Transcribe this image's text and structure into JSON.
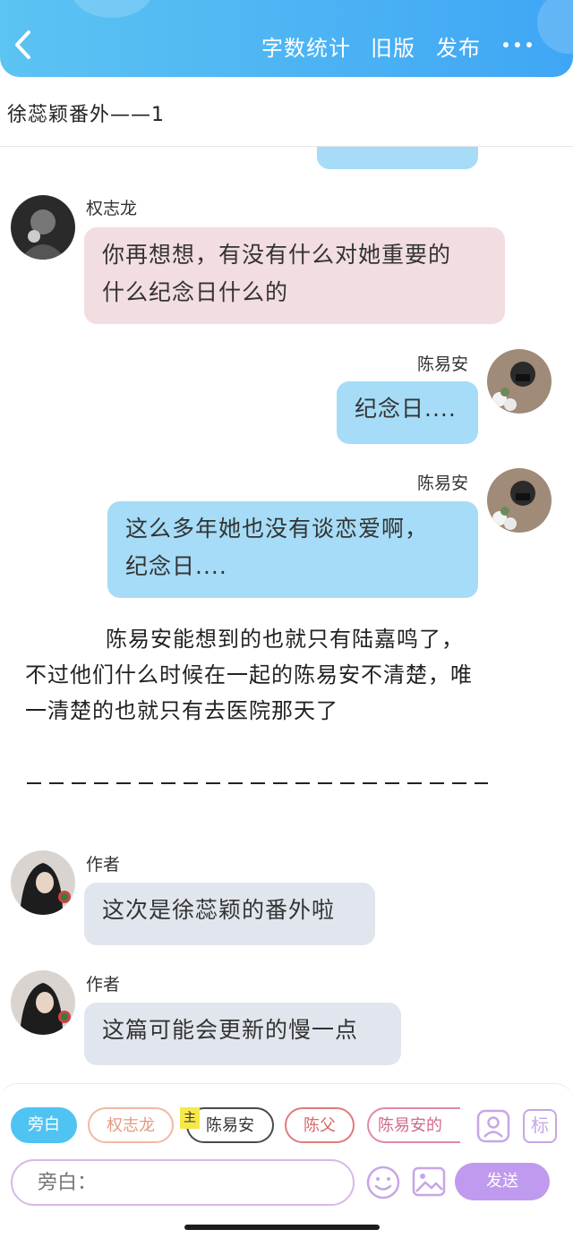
{
  "header": {
    "back_icon": "chevron-left-icon",
    "word_count_label": "字数统计",
    "old_version_label": "旧版",
    "publish_label": "发布",
    "more_icon": "more-horizontal-icon",
    "accent_color": "#45aef5"
  },
  "document": {
    "title": "徐蕊颖番外——1"
  },
  "messages": [
    {
      "speaker": "权志龙",
      "text_lines": [
        "你再想想，有没有什么对她重要的",
        "什么纪念日什么的"
      ],
      "side": "left",
      "bubble_color": "#f2dde0"
    },
    {
      "speaker": "陈易安",
      "text_lines": [
        "纪念日...."
      ],
      "side": "right",
      "bubble_color": "#a6dcf7"
    },
    {
      "speaker": "陈易安",
      "text_lines": [
        "这么多年她也没有谈恋爱啊，",
        "纪念日...."
      ],
      "side": "right",
      "bubble_color": "#a6dcf7"
    },
    {
      "speaker": "作者",
      "text_lines": [
        "这次是徐蕊颖的番外啦"
      ],
      "side": "left",
      "bubble_color": "#e1e6ee"
    },
    {
      "speaker": "作者",
      "text_lines": [
        "这篇可能会更新的慢一点"
      ],
      "side": "left",
      "bubble_color": "#e1e6ee"
    }
  ],
  "narration": {
    "lines": [
      "陈易安能想到的也就只有陆嘉鸣了，",
      "不过他们什么时候在一起的陈易安不清楚，唯",
      "一清楚的也就只有去医院那天了"
    ]
  },
  "composer": {
    "roles": [
      "旁白",
      "权志龙",
      "陈易安",
      "陈父",
      "陈易安的"
    ],
    "main_tag": "主",
    "input_placeholder": "旁白：",
    "send_label": "发送",
    "role_icon": "person-icon",
    "mark_label": "标",
    "emoji_icon": "smiley-icon",
    "image_icon": "image-icon",
    "send_color": "#c09aee"
  }
}
